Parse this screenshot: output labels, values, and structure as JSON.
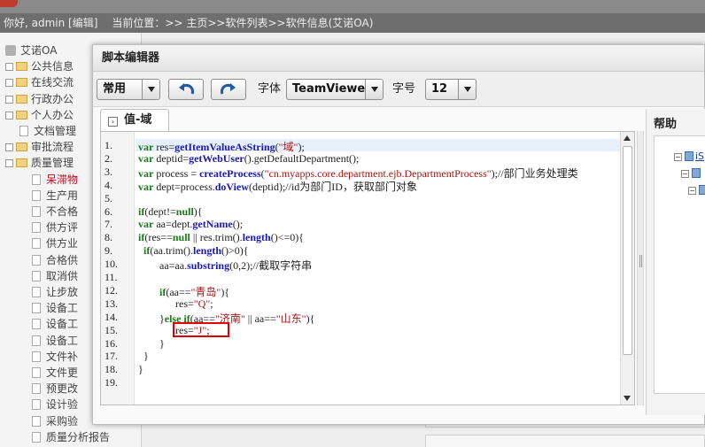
{
  "app": {
    "user_info": "你好, admin [编辑]",
    "location": "当前位置：>> 主页>>软件列表>>软件信息(艾诺OA)"
  },
  "sidebar": {
    "items": [
      {
        "label": "艾诺OA",
        "type": "root"
      },
      {
        "label": "公共信息",
        "type": "folder"
      },
      {
        "label": "在线交流",
        "type": "folder"
      },
      {
        "label": "行政办公",
        "type": "folder"
      },
      {
        "label": "个人办公",
        "type": "folder"
      },
      {
        "label": "文档管理",
        "type": "doc"
      },
      {
        "label": "审批流程",
        "type": "folder"
      },
      {
        "label": "质量管理",
        "type": "folder-open"
      },
      {
        "label": "呆滞物",
        "type": "doc",
        "selected": true
      },
      {
        "label": "生产用",
        "type": "doc"
      },
      {
        "label": "不合格",
        "type": "doc"
      },
      {
        "label": "供方评",
        "type": "doc"
      },
      {
        "label": "供方业",
        "type": "doc"
      },
      {
        "label": "合格供",
        "type": "doc"
      },
      {
        "label": "取消供",
        "type": "doc"
      },
      {
        "label": "让步放",
        "type": "doc"
      },
      {
        "label": "设备工",
        "type": "doc"
      },
      {
        "label": "设备工",
        "type": "doc"
      },
      {
        "label": "设备工",
        "type": "doc"
      },
      {
        "label": "文件补",
        "type": "doc"
      },
      {
        "label": "文件更",
        "type": "doc"
      },
      {
        "label": "预更改",
        "type": "doc"
      },
      {
        "label": "设计验",
        "type": "doc"
      },
      {
        "label": "采购验",
        "type": "doc"
      },
      {
        "label": "质量分析报告",
        "type": "doc"
      }
    ]
  },
  "modal": {
    "title": "脚本编辑器",
    "toolbar": {
      "mode_value": "常用",
      "font_label": "字体",
      "font_value": "TeamViewer",
      "size_label": "字号",
      "size_value": "12"
    },
    "tab_label": "值-域",
    "help_title": "帮助",
    "help_tree": [
      {
        "label": "iS",
        "level": 0
      },
      {
        "label": "",
        "level": 1
      },
      {
        "label": "",
        "level": 2
      }
    ],
    "code_lines": [
      "var res=getItemValueAsString(\"域\");",
      "var deptid=getWebUser().getDefaultDepartment();",
      "var process = createProcess(\"cn.myapps.core.department.ejb.DepartmentProcess\");//部门业务处理类",
      "var dept=process.doView(deptid);//id为部门ID，获取部门对象",
      "",
      "if(dept!=null){",
      "var aa=dept.getName();",
      "if(res==null || res.trim().length()<=0){",
      "  if(aa.trim().length()>0){",
      "        aa=aa.substring(0,2);//截取字符串",
      "",
      "        if(aa==\"青岛\"){",
      "              res=\"Q\";",
      "        }else if(aa==\"济南\" || aa==\"山东\"){",
      "              res=\"J\";",
      "        }",
      "  }",
      "}",
      ""
    ]
  },
  "colors": {
    "keyword": "#1a7a1a",
    "function": "#1a1ab0",
    "string": "#a31515",
    "highlight_box": "#e00000",
    "sidebar_selected": "#d0021b"
  }
}
